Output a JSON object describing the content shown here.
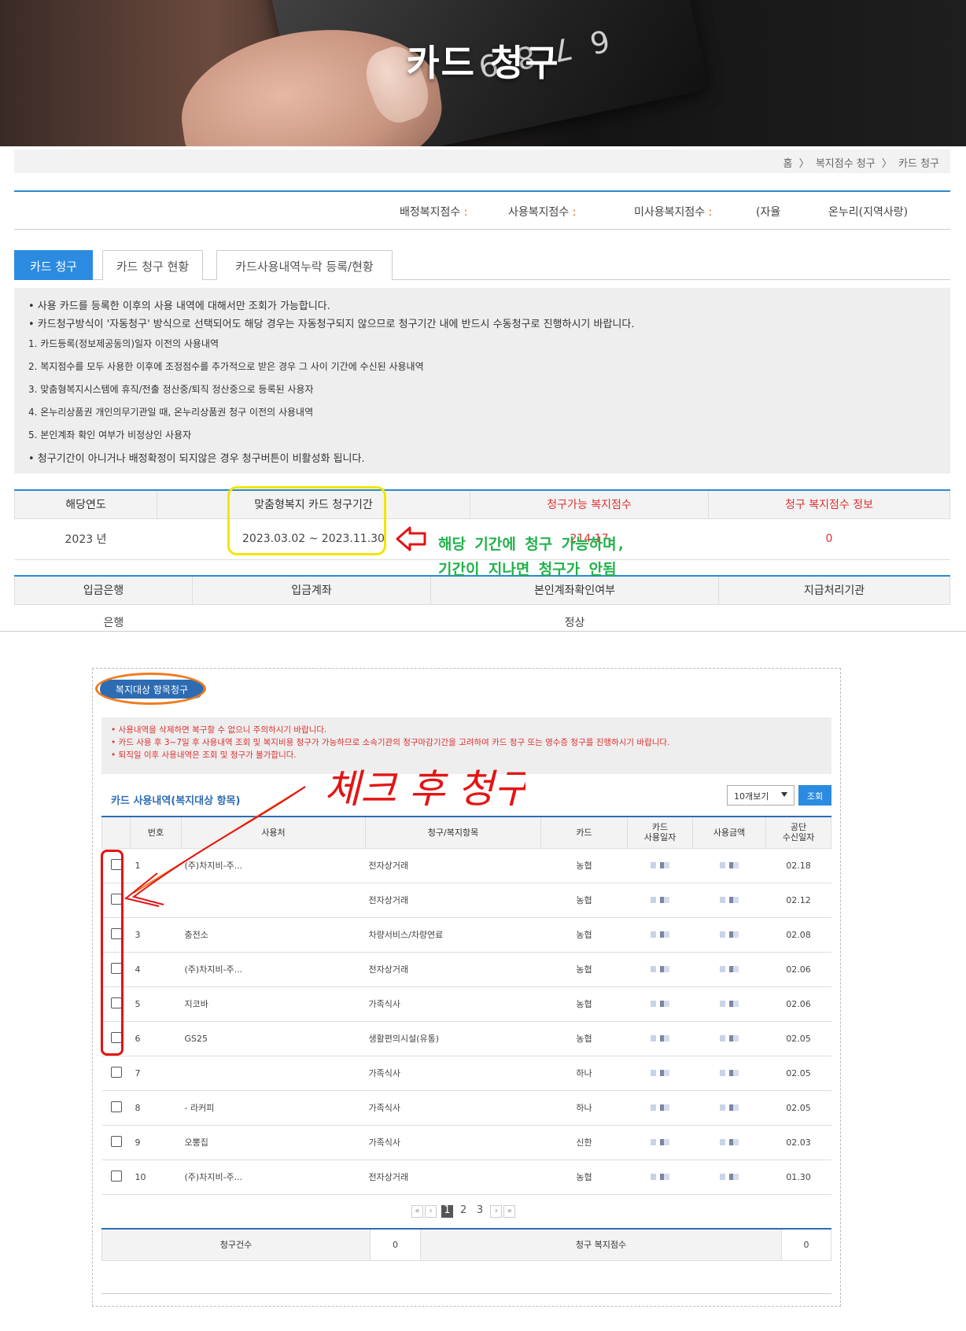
{
  "hero": {
    "title": "카드 청구"
  },
  "breadcrumb": {
    "home": "홈",
    "sep1": "〉",
    "level1": "복지점수 청구",
    "sep2": "〉",
    "level2": "카드 청구"
  },
  "points": {
    "assigned_label": "배정복지점수",
    "used_label": "사용복지점수",
    "unused_label": "미사용복지점수",
    "free_label": "(자율",
    "onnuri_label": "온누리(지역사랑)"
  },
  "tabs": [
    {
      "label": "카드 청구",
      "active": true
    },
    {
      "label": "카드 청구 현황",
      "active": false
    },
    {
      "label": "카드사용내역누락 등록/현황",
      "active": false
    }
  ],
  "notice": [
    "• 사용 카드를 등록한 이후의 사용 내역에 대해서만 조회가 가능합니다.",
    "• 카드청구방식이 '자동청구' 방식으로 선택되어도 해당 경우는 자동청구되지 않으므로 청구기간 내에 반드시 수동청구로 진행하시기 바랍니다.",
    "1. 카드등록(정보제공동의)일자 이전의 사용내역",
    "2. 복지점수를 모두 사용한 이후에 조정점수를 추가적으로 받은 경우 그 사이 기간에 수신된 사용내역",
    "3. 맞춤형복지시스템에 휴직/전출 정산중/퇴직 정산중으로 등록된 사용자",
    "4. 온누리상품권 개인의무기관일 때, 온누리상품권 청구 이전의 사용내역",
    "5. 본인계좌 확인 여부가 비정상인 사용자",
    "• 청구기간이 아니거나 배정확정이 되지않은 경우 청구버튼이 비활성화 됩니다."
  ],
  "period_table": {
    "headers": [
      "해당연도",
      "맞춤형복지 카드 청구기간",
      "청구가능 복지점수",
      "청구 복지점수 정보"
    ],
    "row": {
      "year": "2023 년",
      "period": "2023.03.02 ~ 2023.11.30",
      "available": "214.17",
      "info": "0"
    }
  },
  "bank_table": {
    "headers": [
      "입금은행",
      "입금계좌",
      "본인계좌확인여부",
      "지급처리기관"
    ],
    "row": {
      "bank": "은행",
      "account": "",
      "verified": "정상",
      "org": ""
    }
  },
  "annotation": {
    "line1": "해당 기간에 청구 가능하며,",
    "line2": "기간이 지나면 청구가 안됨",
    "scribble": "체크 후 청구"
  },
  "panel": {
    "button": "복지대상 항목청구",
    "warnings": [
      "• 사용내역을 삭제하면 복구할 수 없으니 주의하시기 바랍니다.",
      "• 카드 사용 후 3~7일 후 사용내역 조회 및 복지비용 청구가 가능하므로 소속기관의 청구마감기간을 고려하여 카드 청구 또는 영수증 청구를 진행하시기 바랍니다.",
      "• 퇴직일 이후 사용내역은 조회 및 청구가 불가합니다."
    ],
    "section_title": "카드 사용내역(복지대상 항목)",
    "page_size": "10개보기",
    "search_button": "조회",
    "headers": [
      "번호",
      "사용처",
      "청구/복지항목",
      "카드",
      "카드\n사용일자",
      "사용금액",
      "공단\n수신일자"
    ],
    "rows": [
      {
        "no": "1",
        "place": "(주)차지비-주...",
        "item": "전자상거래",
        "card": "농협",
        "recv": "02.18"
      },
      {
        "no": "",
        "place": "",
        "item": "전자상거래",
        "card": "농협",
        "recv": "02.12"
      },
      {
        "no": "3",
        "place": "충전소",
        "item": "차량서비스/차량연료",
        "card": "농협",
        "recv": "02.08"
      },
      {
        "no": "4",
        "place": "(주)차지비-주...",
        "item": "전자상거래",
        "card": "농협",
        "recv": "02.06"
      },
      {
        "no": "5",
        "place": "지코바",
        "item": "가족식사",
        "card": "농협",
        "recv": "02.06"
      },
      {
        "no": "6",
        "place": "GS25",
        "item": "생활편의시설(유통)",
        "card": "농협",
        "recv": "02.05"
      },
      {
        "no": "7",
        "place": "",
        "item": "가족식사",
        "card": "하나",
        "recv": "02.05"
      },
      {
        "no": "8",
        "place": "- 라커피",
        "item": "가족식사",
        "card": "하나",
        "recv": "02.05"
      },
      {
        "no": "9",
        "place": "오뽕집",
        "item": "가족식사",
        "card": "신한",
        "recv": "02.03"
      },
      {
        "no": "10",
        "place": "(주)차지비-주...",
        "item": "전자상거래",
        "card": "농협",
        "recv": "01.30"
      }
    ],
    "pager": {
      "pages": [
        "1",
        "2",
        "3"
      ],
      "current": "1"
    },
    "summary": {
      "count_label": "청구건수",
      "count": "0",
      "points_label": "청구 복지점수",
      "points": "0"
    }
  },
  "colors": {
    "accent": "#2b8be0",
    "red": "#e03030",
    "highlight_yellow": "#f2e600",
    "annotation_green": "#22b24c",
    "annotation_red": "#e31414",
    "annotation_orange": "#ef7c1e"
  }
}
